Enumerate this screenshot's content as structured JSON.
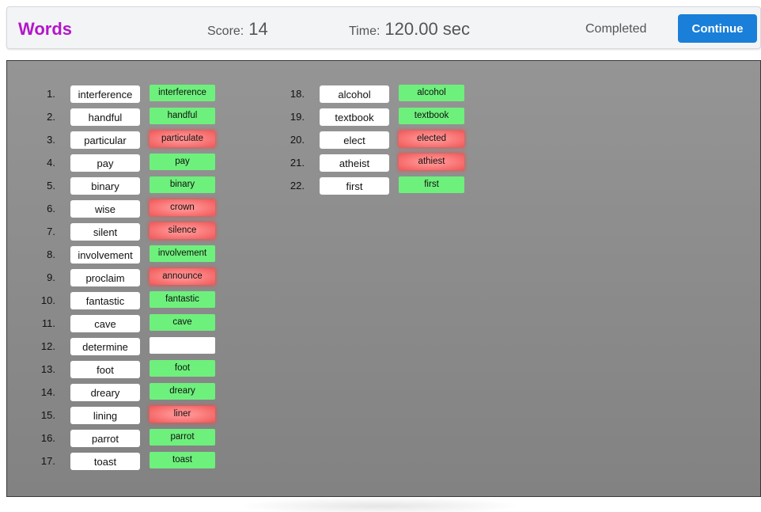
{
  "header": {
    "title": "Words",
    "score_label": "Score:",
    "score_value": "14",
    "time_label": "Time:",
    "time_value": "120.00 sec",
    "status": "Completed",
    "continue_label": "Continue"
  },
  "colors": {
    "title": "#b316c9",
    "button": "#1a7fd8",
    "correct": "#6ef07c",
    "wrong": "#f05757"
  },
  "items": [
    {
      "num": "1.",
      "word": "interference",
      "response": "interference",
      "status": "correct"
    },
    {
      "num": "2.",
      "word": "handful",
      "response": "handful",
      "status": "correct"
    },
    {
      "num": "3.",
      "word": "particular",
      "response": "particulate",
      "status": "wrong"
    },
    {
      "num": "4.",
      "word": "pay",
      "response": "pay",
      "status": "correct"
    },
    {
      "num": "5.",
      "word": "binary",
      "response": "binary",
      "status": "correct"
    },
    {
      "num": "6.",
      "word": "wise",
      "response": "crown",
      "status": "wrong"
    },
    {
      "num": "7.",
      "word": "silent",
      "response": "silence",
      "status": "wrong"
    },
    {
      "num": "8.",
      "word": "involvement",
      "response": "involvement",
      "status": "correct"
    },
    {
      "num": "9.",
      "word": "proclaim",
      "response": "announce",
      "status": "wrong"
    },
    {
      "num": "10.",
      "word": "fantastic",
      "response": "fantastic",
      "status": "correct"
    },
    {
      "num": "11.",
      "word": "cave",
      "response": "cave",
      "status": "correct"
    },
    {
      "num": "12.",
      "word": "determine",
      "response": "",
      "status": "empty"
    },
    {
      "num": "13.",
      "word": "foot",
      "response": "foot",
      "status": "correct"
    },
    {
      "num": "14.",
      "word": "dreary",
      "response": "dreary",
      "status": "correct"
    },
    {
      "num": "15.",
      "word": "lining",
      "response": "liner",
      "status": "wrong"
    },
    {
      "num": "16.",
      "word": "parrot",
      "response": "parrot",
      "status": "correct"
    },
    {
      "num": "17.",
      "word": "toast",
      "response": "toast",
      "status": "correct"
    },
    {
      "num": "18.",
      "word": "alcohol",
      "response": "alcohol",
      "status": "correct"
    },
    {
      "num": "19.",
      "word": "textbook",
      "response": "textbook",
      "status": "correct"
    },
    {
      "num": "20.",
      "word": "elect",
      "response": "elected",
      "status": "wrong"
    },
    {
      "num": "21.",
      "word": "atheist",
      "response": "athiest",
      "status": "wrong"
    },
    {
      "num": "22.",
      "word": "first",
      "response": "first",
      "status": "correct"
    }
  ]
}
